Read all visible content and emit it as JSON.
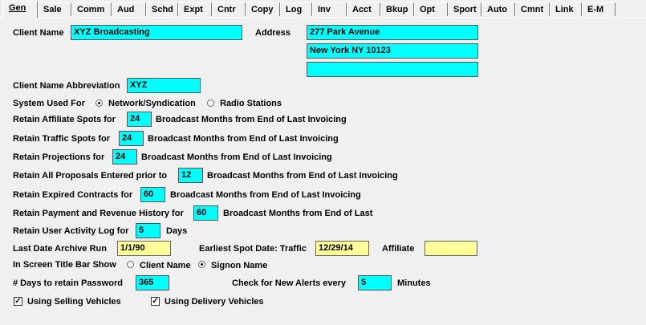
{
  "tabs": [
    "Gen",
    "Sale",
    "Comm",
    "Aud",
    "Schd",
    "Expt",
    "Cntr",
    "Copy",
    "Log",
    "Inv",
    "Acct",
    "Bkup",
    "Opt",
    "Sport",
    "Auto",
    "Cmnt",
    "Link",
    "E-M"
  ],
  "client": {
    "name_label": "Client Name",
    "name_value": "XYZ Broadcasting",
    "address_label": "Address",
    "address_line1": "277 Park Avenue",
    "address_line2": "New York NY 10123",
    "address_line3": "",
    "abbrev_label": "Client Name Abbreviation",
    "abbrev_value": "XYZ"
  },
  "system": {
    "label": "System Used For",
    "opt1": "Network/Syndication",
    "opt2": "Radio Stations",
    "selected": "Network/Syndication"
  },
  "retain": {
    "affiliate_pre": "Retain Affiliate Spots for",
    "affiliate_val": "24",
    "affiliate_post": "Broadcast Months from End of Last Invoicing",
    "traffic_pre": "Retain Traffic Spots for",
    "traffic_val": "24",
    "traffic_post": "Broadcast Months from End of Last Invoicing",
    "projections_pre": "Retain Projections for",
    "projections_val": "24",
    "projections_post": "Broadcast Months from End of Last Invoicing",
    "proposals_pre": "Retain All Proposals Entered prior to",
    "proposals_val": "12",
    "proposals_post": "Broadcast Months from End of Last Invoicing",
    "contracts_pre": "Retain Expired Contracts for",
    "contracts_val": "60",
    "contracts_post": "Broadcast Months from End of Last Invoicing",
    "payment_pre": "Retain Payment and Revenue History for",
    "payment_val": "60",
    "payment_post": "Broadcast Months from End of Last",
    "activity_pre": "Retain User Activity Log for",
    "activity_val": "5",
    "activity_post": "Days"
  },
  "archive": {
    "last_label": "Last Date Archive Run",
    "last_value": "1/1/90",
    "earliest_label": "Earliest Spot Date: Traffic",
    "earliest_value": "12/29/14",
    "affiliate_label": "Affiliate",
    "affiliate_value": ""
  },
  "title_bar": {
    "label": "In Screen Title Bar Show",
    "opt1": "Client Name",
    "opt2": "Signon Name",
    "selected": "Signon Name"
  },
  "password": {
    "label": "# Days to retain Password",
    "value": "365",
    "alerts_label": "Check for New Alerts every",
    "alerts_value": "5",
    "alerts_unit": "Minutes"
  },
  "checks": {
    "selling_label": "Using Selling Vehicles",
    "selling_checked": true,
    "delivery_label": "Using Delivery Vehicles",
    "delivery_checked": true
  },
  "colors": {
    "field": "#00ffff",
    "field_yellow": "#ffff99",
    "background": "#f0f0f0"
  }
}
